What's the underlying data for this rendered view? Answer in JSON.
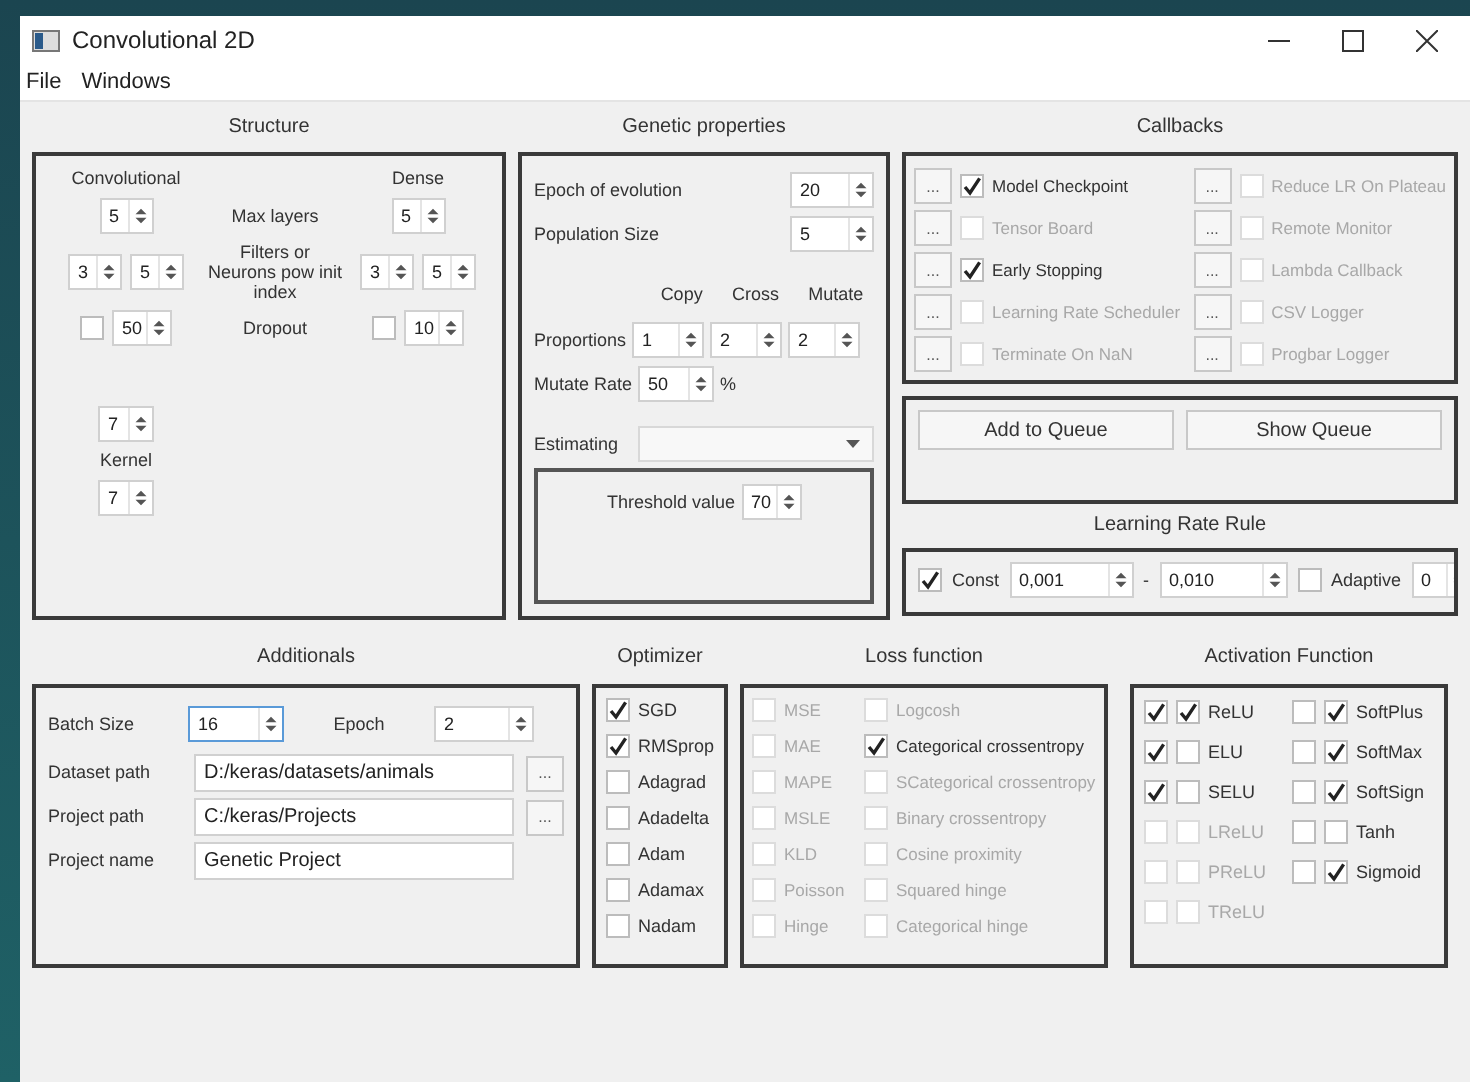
{
  "window": {
    "title": "Convolutional 2D"
  },
  "menu": [
    {
      "label": "File"
    },
    {
      "label": "Windows"
    }
  ],
  "structure": {
    "title": "Structure",
    "conv_header": "Convolutional",
    "dense_header": "Dense",
    "rows": [
      {
        "label": "Max layers",
        "conv": {
          "spins": [
            "5"
          ]
        },
        "dense": {
          "spins": [
            "5"
          ]
        }
      },
      {
        "label": "Filters or Neurons pow init index",
        "conv": {
          "spins": [
            "3",
            "5"
          ]
        },
        "dense": {
          "spins": [
            "3",
            "5"
          ]
        }
      },
      {
        "label": "Dropout",
        "conv": {
          "checked": false,
          "spins": [
            "50"
          ]
        },
        "dense": {
          "checked": false,
          "spins": [
            "10"
          ]
        }
      }
    ],
    "kernel": {
      "label": "Kernel",
      "spins": [
        "7",
        "7"
      ]
    }
  },
  "genetic": {
    "title": "Genetic properties",
    "fields": [
      {
        "label": "Epoch of evolution",
        "value": "20"
      },
      {
        "label": "Population Size",
        "value": "5"
      }
    ],
    "proportion_headers": [
      "Copy",
      "Cross",
      "Mutate"
    ],
    "proportions": {
      "label": "Proportions",
      "values": [
        "1",
        "2",
        "2"
      ]
    },
    "mutate_rate": {
      "label": "Mutate Rate",
      "value": "50",
      "unit": "%"
    },
    "estimating": {
      "label": "Estimating"
    },
    "threshold": {
      "label": "Threshold value",
      "value": "70"
    }
  },
  "callbacks": {
    "title": "Callbacks",
    "columns": [
      [
        {
          "button": "...",
          "label": "Model Checkpoint",
          "checked": true,
          "enabled": true
        },
        {
          "button": "...",
          "label": "Tensor Board",
          "checked": false,
          "enabled": false
        },
        {
          "button": "...",
          "label": "Early Stopping",
          "checked": true,
          "enabled": true
        },
        {
          "button": "...",
          "label": "Learning Rate Scheduler",
          "checked": false,
          "enabled": false
        },
        {
          "button": "...",
          "label": "Terminate On NaN",
          "checked": false,
          "enabled": false
        }
      ],
      [
        {
          "button": "...",
          "label": "Reduce LR On Plateau",
          "checked": false,
          "enabled": false
        },
        {
          "button": "...",
          "label": "Remote Monitor",
          "checked": false,
          "enabled": false
        },
        {
          "button": "...",
          "label": "Lambda Callback",
          "checked": false,
          "enabled": false
        },
        {
          "button": "...",
          "label": "CSV Logger",
          "checked": false,
          "enabled": false
        },
        {
          "button": "...",
          "label": "Progbar Logger",
          "checked": false,
          "enabled": false
        }
      ]
    ]
  },
  "queue": {
    "buttons": [
      "Add to Queue",
      "Show Queue"
    ]
  },
  "learning_rate": {
    "title": "Learning Rate Rule",
    "const": {
      "label": "Const",
      "checked": true
    },
    "from": "0,001",
    "separator": "-",
    "to": "0,010",
    "adaptive": {
      "label": "Adaptive",
      "checked": false
    },
    "adaptive_value": "0"
  },
  "additionals": {
    "title": "Additionals",
    "batch_size": {
      "label": "Batch Size",
      "value": "16",
      "focused": true
    },
    "epoch": {
      "label": "Epoch",
      "value": "2"
    },
    "paths": [
      {
        "label": "Dataset path",
        "value": "D:/keras/datasets/animals",
        "button": "..."
      },
      {
        "label": "Project path",
        "value": "C:/keras/Projects",
        "button": "..."
      },
      {
        "label": "Project name",
        "value": "Genetic Project"
      }
    ]
  },
  "optimizer": {
    "title": "Optimizer",
    "items": [
      {
        "label": "SGD",
        "checked": true
      },
      {
        "label": "RMSprop",
        "checked": true
      },
      {
        "label": "Adagrad",
        "checked": false
      },
      {
        "label": "Adadelta",
        "checked": false
      },
      {
        "label": "Adam",
        "checked": false
      },
      {
        "label": "Adamax",
        "checked": false
      },
      {
        "label": "Nadam",
        "checked": false
      }
    ]
  },
  "loss": {
    "title": "Loss function",
    "columns": [
      [
        {
          "label": "MSE",
          "checked": false,
          "enabled": false
        },
        {
          "label": "MAE",
          "checked": false,
          "enabled": false
        },
        {
          "label": "MAPE",
          "checked": false,
          "enabled": false
        },
        {
          "label": "MSLE",
          "checked": false,
          "enabled": false
        },
        {
          "label": "KLD",
          "checked": false,
          "enabled": false
        },
        {
          "label": "Poisson",
          "checked": false,
          "enabled": false
        },
        {
          "label": "Hinge",
          "checked": false,
          "enabled": false
        }
      ],
      [
        {
          "label": "Logcosh",
          "checked": false,
          "enabled": false
        },
        {
          "label": "Categorical crossentropy",
          "checked": true,
          "enabled": true
        },
        {
          "label": "SCategorical crossentropy",
          "checked": false,
          "enabled": false
        },
        {
          "label": "Binary crossentropy",
          "checked": false,
          "enabled": false
        },
        {
          "label": "Cosine proximity",
          "checked": false,
          "enabled": false
        },
        {
          "label": "Squared hinge",
          "checked": false,
          "enabled": false
        },
        {
          "label": "Categorical hinge",
          "checked": false,
          "enabled": false
        }
      ]
    ]
  },
  "activation": {
    "title": "Activation Function",
    "columns": [
      [
        {
          "label": "ReLU",
          "enabled": true,
          "checks": [
            true,
            true
          ]
        },
        {
          "label": "ELU",
          "enabled": true,
          "checks": [
            true,
            false
          ]
        },
        {
          "label": "SELU",
          "enabled": true,
          "checks": [
            true,
            false
          ]
        },
        {
          "label": "LReLU",
          "enabled": false,
          "checks": [
            false,
            false
          ]
        },
        {
          "label": "PReLU",
          "enabled": false,
          "checks": [
            false,
            false
          ]
        },
        {
          "label": "TReLU",
          "enabled": false,
          "checks": [
            false,
            false
          ]
        }
      ],
      [
        {
          "label": "SoftPlus",
          "enabled": true,
          "checks": [
            false,
            true
          ]
        },
        {
          "label": "SoftMax",
          "enabled": true,
          "checks": [
            false,
            true
          ]
        },
        {
          "label": "SoftSign",
          "enabled": true,
          "checks": [
            false,
            true
          ]
        },
        {
          "label": "Tanh",
          "enabled": true,
          "checks": [
            false,
            false
          ]
        },
        {
          "label": "Sigmoid",
          "enabled": true,
          "checks": [
            false,
            true
          ]
        }
      ]
    ]
  }
}
